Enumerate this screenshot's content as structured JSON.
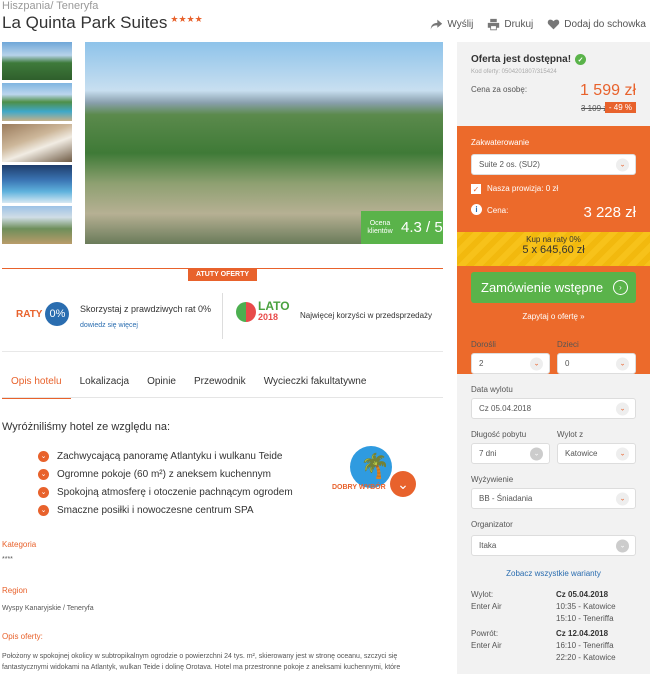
{
  "breadcrumb": {
    "country": "Hiszpania",
    "region": "Teneryfa",
    "sep": "/ "
  },
  "hotel": {
    "name": "La Quinta Park Suites",
    "stars": "★★★★"
  },
  "actions": {
    "share": "Wyślij",
    "print": "Drukuj",
    "save": "Dodaj do schowka"
  },
  "rating": {
    "label": "Ocena klientów",
    "value": "4.3 / 5"
  },
  "atuty": {
    "header": "ATUTY OFERTY",
    "raty_logo": "RATY",
    "raty_pct": "0%",
    "raty_text": "Skorzystaj z prawdziwych rat 0%",
    "raty_link": "dowiedz się więcej",
    "lato_word": "LATO",
    "lato_year": "2018",
    "lato_text": "Najwięcej korzyści w przedsprzedaży"
  },
  "tabs": [
    "Opis hotelu",
    "Lokalizacja",
    "Opinie",
    "Przewodnik",
    "Wycieczki fakultatywne"
  ],
  "description": {
    "heading": "Wyróżniliśmy hotel ze względu na:",
    "features": [
      "Zachwycającą panoramę Atlantyku i wulkanu Teide",
      "Ogromne pokoje (60 m²) z aneksem kuchennym",
      "Spokojną atmosferę i otoczenie pachnącym ogrodem",
      "Smaczne posiłki i nowoczesne centrum SPA"
    ],
    "badge": "DOBRY WYBÓR",
    "kategoria_label": "Kategoria",
    "kategoria_value": "****",
    "region_label": "Region",
    "region_value": "Wyspy Kanaryjskie / Teneryfa",
    "opis_label": "Opis oferty:",
    "opis_text": "Położony w spokojnej okolicy w subtropikalnym ogrodzie o powierzchni 24 tys. m², skierowany jest w stronę oceanu, szczyci się fantastycznymi widokami na Atlantyk, wulkan Teide i dolinę Orotava. Hotel ma przestronne pokoje z aneksami kuchennymi, które"
  },
  "offer": {
    "available": "Oferta jest dostępna!",
    "code": "Kod oferty: 0504201807/315424",
    "price_per_person_label": "Cena za osobę:",
    "price_per_person": "1 599 zł",
    "old_price": "3 109 zł",
    "discount": "- 49 %",
    "accommodation_label": "Zakwaterowanie",
    "accommodation_value": "Suite 2 os. (SU2)",
    "commission": "Nasza prowizja: 0 zł",
    "total_label": "Cena:",
    "total_price": "3 228 zł",
    "raty_line1": "Kup na raty 0%",
    "raty_line2": "5 x 645,60 zł",
    "order_button": "Zamówienie wstępne",
    "ask_link": "Zapytaj o ofertę »"
  },
  "form": {
    "adults_label": "Dorośli",
    "adults_value": "2",
    "children_label": "Dzieci",
    "children_value": "0",
    "departure_label": "Data wylotu",
    "departure_value": "Cz 05.04.2018",
    "duration_label": "Długość pobytu",
    "duration_value": "7 dni",
    "from_label": "Wylot z",
    "from_value": "Katowice",
    "board_label": "Wyżywienie",
    "board_value": "BB - Śniadania",
    "organizer_label": "Organizator",
    "organizer_value": "Itaka",
    "variants_link": "Zobacz wszystkie warianty"
  },
  "flights": {
    "out_label": "Wylot:",
    "out_airline": "Enter Air",
    "out_date": "Cz 05.04.2018",
    "out_t1": "10:35 - Katowice",
    "out_t2": "15:10 - Teneriffa",
    "ret_label": "Powrót:",
    "ret_airline": "Enter Air",
    "ret_date": "Cz 12.04.2018",
    "ret_t1": "16:10 - Teneriffa",
    "ret_t2": "22:20 - Katowice"
  },
  "colors": {
    "accent": "#e8622c",
    "green": "#5ab34a",
    "link": "#2a6db0",
    "yellow": "#f7c21a"
  }
}
